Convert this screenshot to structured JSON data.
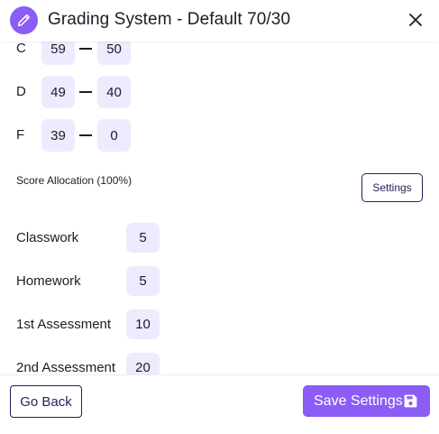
{
  "header": {
    "title": "Grading System - Default 70/30",
    "icon": "pencil-icon",
    "close_icon": "close-icon"
  },
  "grades": [
    {
      "letter": "C",
      "min": "59",
      "max": "50"
    },
    {
      "letter": "D",
      "min": "49",
      "max": "40"
    },
    {
      "letter": "F",
      "min": "39",
      "max": "0"
    }
  ],
  "allocation": {
    "label": "Score Allocation (100%)",
    "settings_label": "Settings"
  },
  "scores": [
    {
      "label": "Classwork",
      "value": "5"
    },
    {
      "label": "Homework",
      "value": "5"
    },
    {
      "label": "1st Assessment",
      "value": "10"
    },
    {
      "label": "2nd Assessment",
      "value": "20"
    }
  ],
  "footer": {
    "back_label": "Go Back",
    "save_label": "Save Settings",
    "save_icon": "floppy-disk-icon"
  },
  "colors": {
    "accent": "#8b5cf6",
    "pill_bg": "#efeafd",
    "outline": "#2b1c5e"
  }
}
